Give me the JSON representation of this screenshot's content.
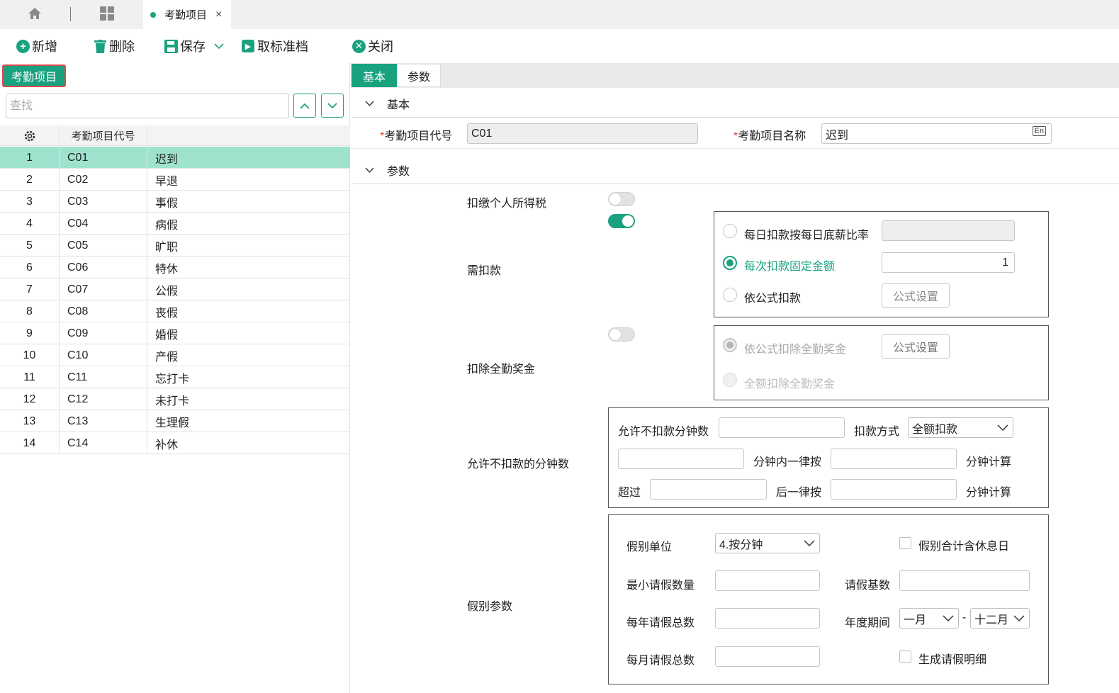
{
  "tabs": {
    "active_label": "考勤项目",
    "close_symbol": "×"
  },
  "toolbar": {
    "add": "新增",
    "delete": "删除",
    "save": "保存",
    "unstandard": "取标准档",
    "close": "关闭"
  },
  "left": {
    "title": "考勤项目",
    "search_placeholder": "查找",
    "col_code": "考勤项目代号",
    "rows": [
      {
        "no": "1",
        "code": "C01",
        "name": "迟到"
      },
      {
        "no": "2",
        "code": "C02",
        "name": "早退"
      },
      {
        "no": "3",
        "code": "C03",
        "name": "事假"
      },
      {
        "no": "4",
        "code": "C04",
        "name": "病假"
      },
      {
        "no": "5",
        "code": "C05",
        "name": "旷职"
      },
      {
        "no": "6",
        "code": "C06",
        "name": "特休"
      },
      {
        "no": "7",
        "code": "C07",
        "name": "公假"
      },
      {
        "no": "8",
        "code": "C08",
        "name": "丧假"
      },
      {
        "no": "9",
        "code": "C09",
        "name": "婚假"
      },
      {
        "no": "10",
        "code": "C10",
        "name": "产假"
      },
      {
        "no": "11",
        "code": "C11",
        "name": "忘打卡"
      },
      {
        "no": "12",
        "code": "C12",
        "name": "未打卡"
      },
      {
        "no": "13",
        "code": "C13",
        "name": "生理假"
      },
      {
        "no": "14",
        "code": "C14",
        "name": "补休"
      }
    ]
  },
  "right": {
    "tab_basic": "基本",
    "tab_param": "参数",
    "section_basic": "基本",
    "section_param": "参数",
    "req_mark": "*",
    "code_label": "考勤项目代号",
    "code_value": "C01",
    "name_label": "考勤项目名称",
    "name_value": "迟到",
    "lang_badge": "En",
    "tax_label": "扣缴个人所得税",
    "deduct_label": "需扣款",
    "radio_daily": "每日扣款按每日底薪比率",
    "radio_fixed": "每次扣款固定金额",
    "fixed_value": "1",
    "radio_formula": "依公式扣款",
    "formula_btn": "公式设置",
    "bonus_label": "扣除全勤奖金",
    "radio_bonus_formula": "依公式扣除全勤奖金",
    "bonus_formula_btn": "公式设置",
    "radio_bonus_full": "全额扣除全勤奖金",
    "minutes_label": "允许不扣款的分钟数",
    "allow_minutes_label": "允许不扣款分钟数",
    "deduct_method_label": "扣款方式",
    "deduct_method_value": "全额扣款",
    "within_minutes_label": "分钟内一律按",
    "minute_calc_1": "分钟计算",
    "exceed_label": "超过",
    "after_label": "后一律按",
    "minute_calc_2": "分钟计算",
    "leave_params_label": "假别参数",
    "leave_unit_label": "假别单位",
    "leave_unit_value": "4.按分钟",
    "include_rest_label": "假别合计含休息日",
    "min_leave_label": "最小请假数量",
    "leave_base_label": "请假基数",
    "yearly_total_label": "每年请假总数",
    "period_label": "年度期间",
    "period_from": "一月",
    "period_sep": "-",
    "period_to": "十二月",
    "monthly_total_label": "每月请假总数",
    "gen_detail_label": "生成请假明细"
  },
  "colors": {
    "accent": "#1aa180",
    "selected_row": "#9fe3cf",
    "required": "#e0453b"
  },
  "state": {
    "tax_toggle": "off",
    "deduct_toggle": "on",
    "bonus_toggle": "off",
    "selected_row": 1
  }
}
